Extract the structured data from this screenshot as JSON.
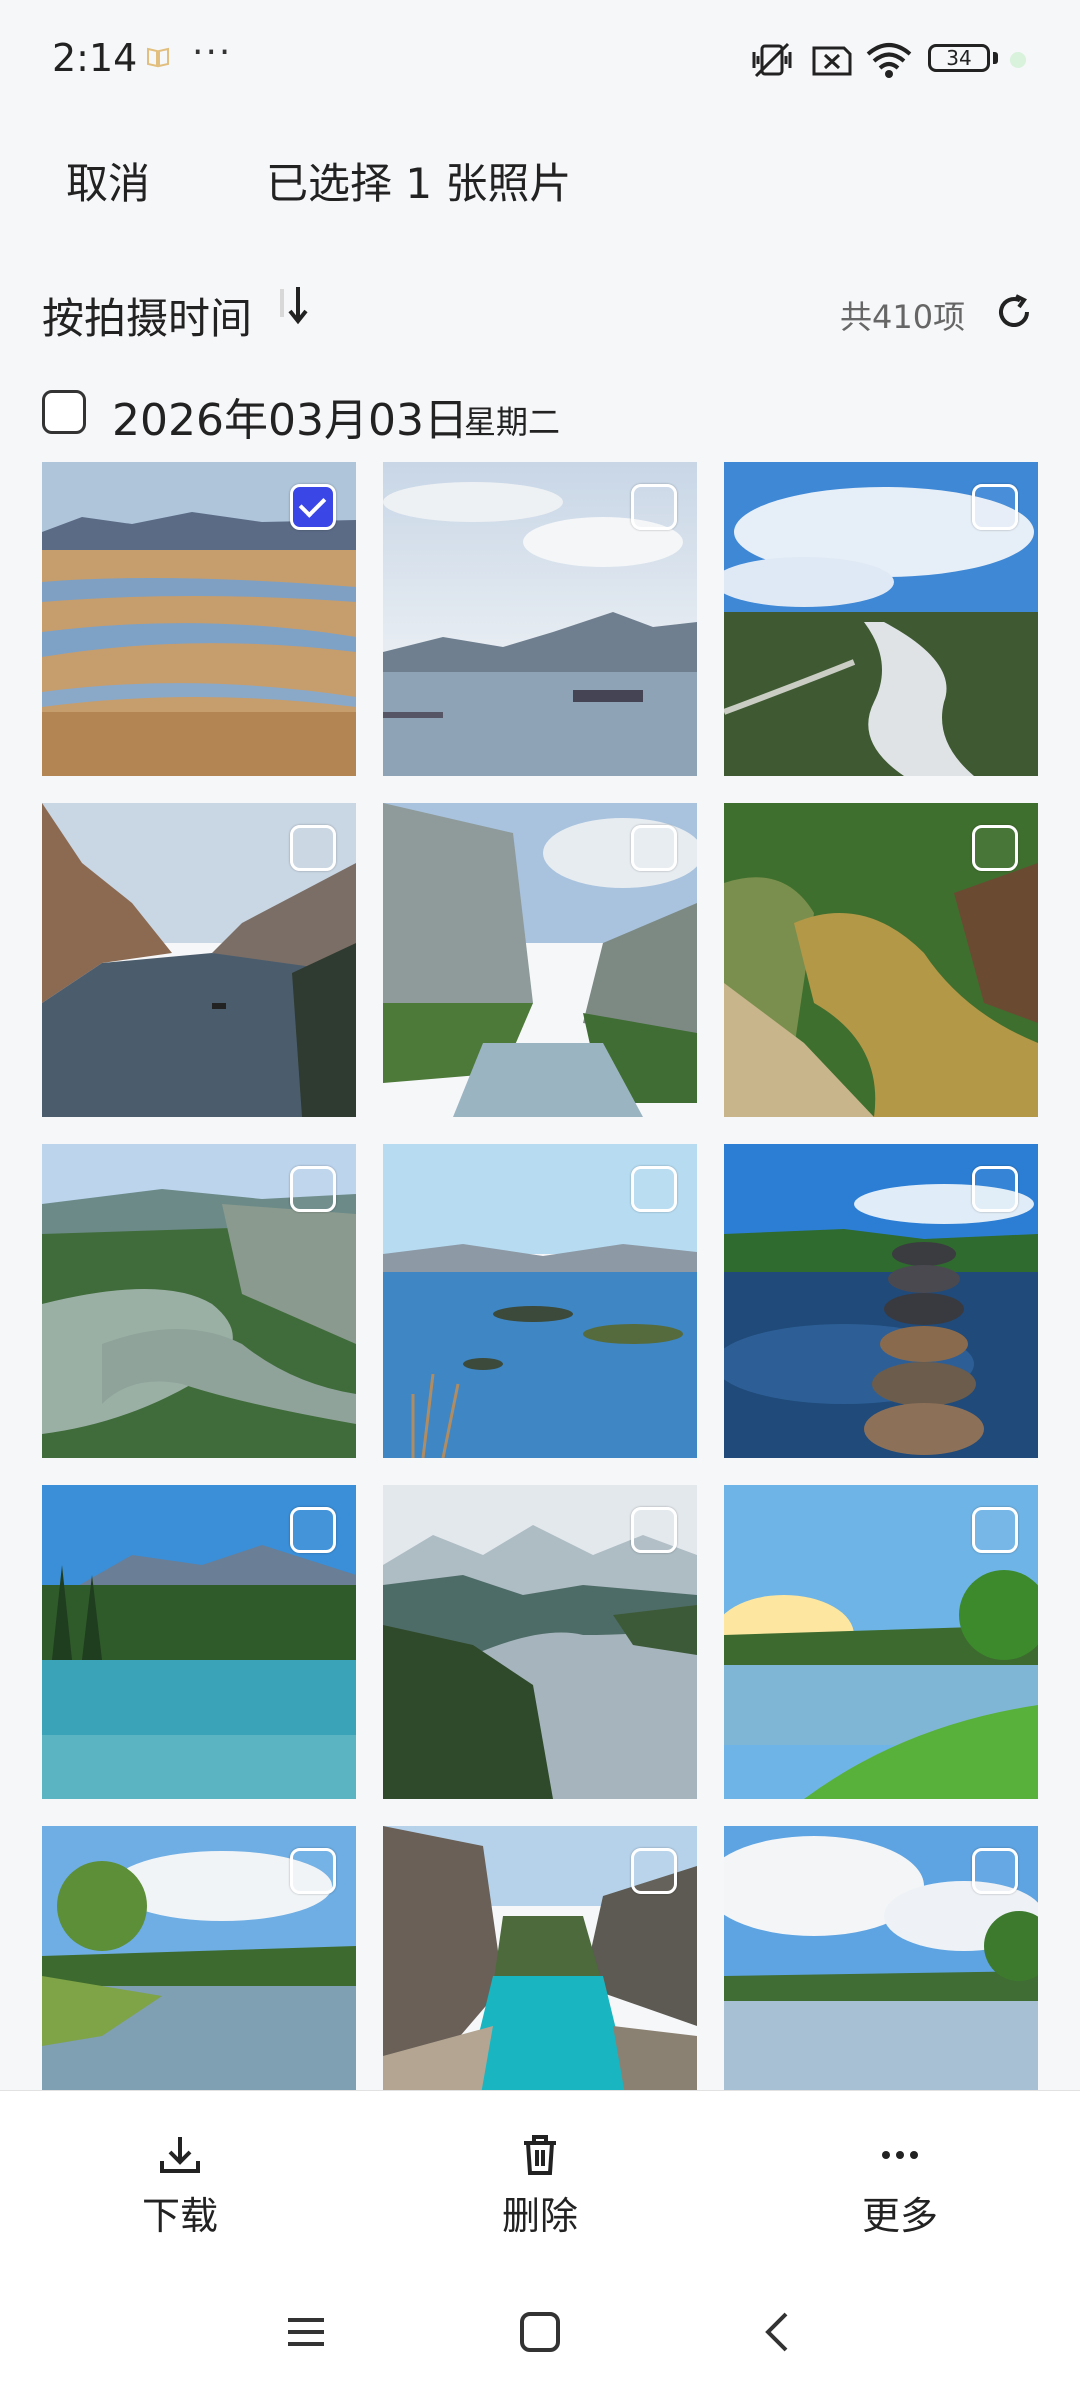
{
  "status_bar": {
    "time": "2:14",
    "dots": "···",
    "battery": "34",
    "icons": [
      "book-icon",
      "mute-vibrate-icon",
      "no-sim-icon",
      "wifi-icon",
      "battery-icon"
    ]
  },
  "header": {
    "cancel": "取消",
    "title": "已选择 1 张照片"
  },
  "sort": {
    "label": "按拍摄时间",
    "count": "共410项"
  },
  "date_group": {
    "date": "2026年03月03日",
    "weekday": "星期二"
  },
  "photos": [
    {
      "name": "wetland-river-mountains",
      "selected": true
    },
    {
      "name": "lake-boat-mountains",
      "selected": false
    },
    {
      "name": "aerial-braided-river",
      "selected": false
    },
    {
      "name": "gorge-river-boat",
      "selected": false
    },
    {
      "name": "cliff-gorge-reflection",
      "selected": false
    },
    {
      "name": "muddy-forest-stream",
      "selected": false
    },
    {
      "name": "river-bend-cliffs",
      "selected": false
    },
    {
      "name": "blue-river-islands",
      "selected": false
    },
    {
      "name": "stacked-stones-stream",
      "selected": false
    },
    {
      "name": "turquoise-lake-pines",
      "selected": false
    },
    {
      "name": "misty-valley-river",
      "selected": false
    },
    {
      "name": "sunset-pond-meadow",
      "selected": false
    },
    {
      "name": "clouds-river-grass",
      "selected": false
    },
    {
      "name": "turquoise-canyon-river",
      "selected": false
    },
    {
      "name": "cloudy-lake-reflection",
      "selected": false
    }
  ],
  "actions": {
    "download": "下载",
    "delete": "删除",
    "more": "更多"
  },
  "colors": {
    "accent": "#3a46e6",
    "background": "#f6f7f9"
  }
}
